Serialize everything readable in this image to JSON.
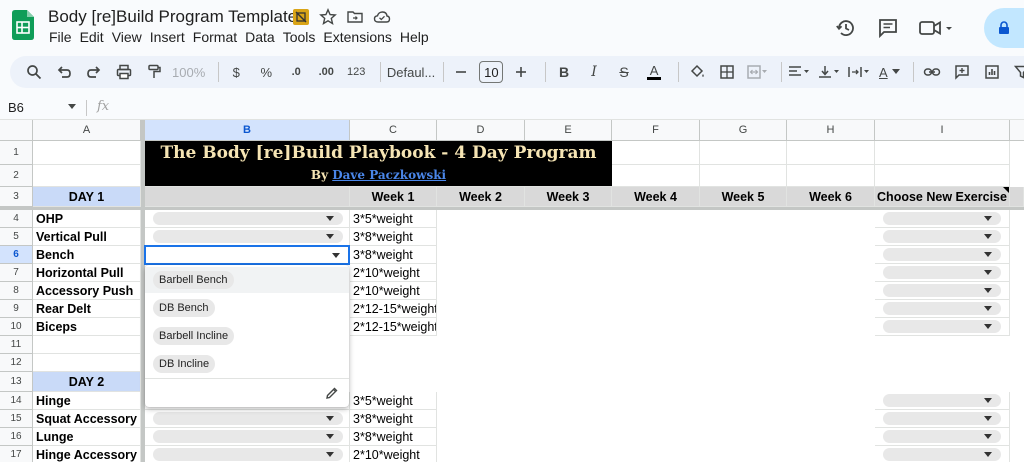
{
  "window": {
    "doc_title": "Body [re]Build Program Template",
    "menu": [
      "File",
      "Edit",
      "View",
      "Insert",
      "Format",
      "Data",
      "Tools",
      "Extensions",
      "Help"
    ]
  },
  "toolbar": {
    "zoom": "100%",
    "currency": "$",
    "percent": "%",
    "dec_decrease": ".0",
    "dec_increase": ".00",
    "number_format": "123",
    "font": "Defaul...",
    "font_size": "10",
    "bold": "B",
    "italic": "I",
    "strike": "S",
    "text_color": "A",
    "text_color_2": "A"
  },
  "formula_bar": {
    "cell_ref": "B6",
    "fx": "fx"
  },
  "columns": [
    "A",
    "B",
    "C",
    "D",
    "E",
    "F",
    "G",
    "H",
    "I"
  ],
  "rows": [
    "1",
    "2",
    "3",
    "4",
    "5",
    "6",
    "7",
    "8",
    "9",
    "10",
    "11",
    "12",
    "13",
    "14",
    "15",
    "16",
    "17"
  ],
  "banner": {
    "title": "The Body [re]Build Playbook - 4 Day Program",
    "by_prefix": "By",
    "author": "Dave Paczkowski"
  },
  "header_row": {
    "day_label": "DAY 1",
    "weeks": [
      "Week 1",
      "Week 2",
      "Week 3",
      "Week 4",
      "Week 5",
      "Week 6"
    ],
    "choose_new": "Choose New Exercise"
  },
  "day1": [
    {
      "row": "4",
      "name": "OHP",
      "week1": "3*5*weight",
      "dropdown": true
    },
    {
      "row": "5",
      "name": "Vertical Pull",
      "week1": "3*8*weight",
      "dropdown": true
    },
    {
      "row": "6",
      "name": "Bench",
      "week1": "3*8*weight",
      "dropdown": false
    },
    {
      "row": "7",
      "name": "Horizontal Pull",
      "week1": "2*10*weight",
      "dropdown": true
    },
    {
      "row": "8",
      "name": "Accessory Push",
      "week1": "2*10*weight",
      "dropdown": true
    },
    {
      "row": "9",
      "name": "Rear Delt",
      "week1": "2*12-15*weight",
      "dropdown": true
    },
    {
      "row": "10",
      "name": "Biceps",
      "week1": "2*12-15*weight",
      "dropdown": true
    }
  ],
  "day2_label": "DAY 2",
  "day2": [
    {
      "row": "14",
      "name": "Hinge",
      "week1": "3*5*weight"
    },
    {
      "row": "15",
      "name": "Squat Accessory",
      "week1": "3*8*weight"
    },
    {
      "row": "16",
      "name": "Lunge",
      "week1": "3*8*weight"
    },
    {
      "row": "17",
      "name": "Hinge Accessory",
      "week1": "2*10*weight"
    }
  ],
  "dropdown_menu": {
    "options": [
      "Barbell Bench",
      "DB Bench",
      "Barbell Incline",
      "DB Incline"
    ],
    "highlighted_index": 0
  },
  "colors": {
    "day_header_bg": "#c9daf8",
    "week_header_bg": "#d9d9d9",
    "banner_bg": "#000000",
    "banner_text": "#f6e5b4",
    "link": "#4a86e8",
    "selection": "#1a73e8"
  }
}
